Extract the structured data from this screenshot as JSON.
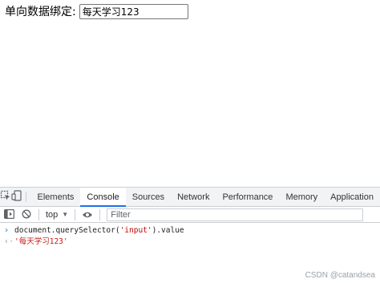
{
  "page": {
    "binding_label": "单向数据绑定:",
    "input_value": "每天学习123"
  },
  "devtools": {
    "tabs": [
      {
        "label": "Elements",
        "active": false
      },
      {
        "label": "Console",
        "active": true
      },
      {
        "label": "Sources",
        "active": false
      },
      {
        "label": "Network",
        "active": false
      },
      {
        "label": "Performance",
        "active": false
      },
      {
        "label": "Memory",
        "active": false
      },
      {
        "label": "Application",
        "active": false
      }
    ],
    "toolbar": {
      "context": "top",
      "filter_placeholder": "Filter"
    },
    "console": {
      "command_prefix": "document.querySelector(",
      "command_arg": "'input'",
      "command_suffix": ").value",
      "result": "'每天学习123'"
    }
  },
  "watermark": "CSDN @catandsea",
  "colors": {
    "accent": "#1a73e8",
    "string": "#c80000",
    "tabbar_bg": "#f1f3f4"
  },
  "icons": {
    "inspect": "inspect-element-icon",
    "device": "device-toolbar-icon",
    "sidebar": "show-sidebar-icon",
    "clear": "clear-console-icon",
    "eye": "live-expression-icon"
  }
}
